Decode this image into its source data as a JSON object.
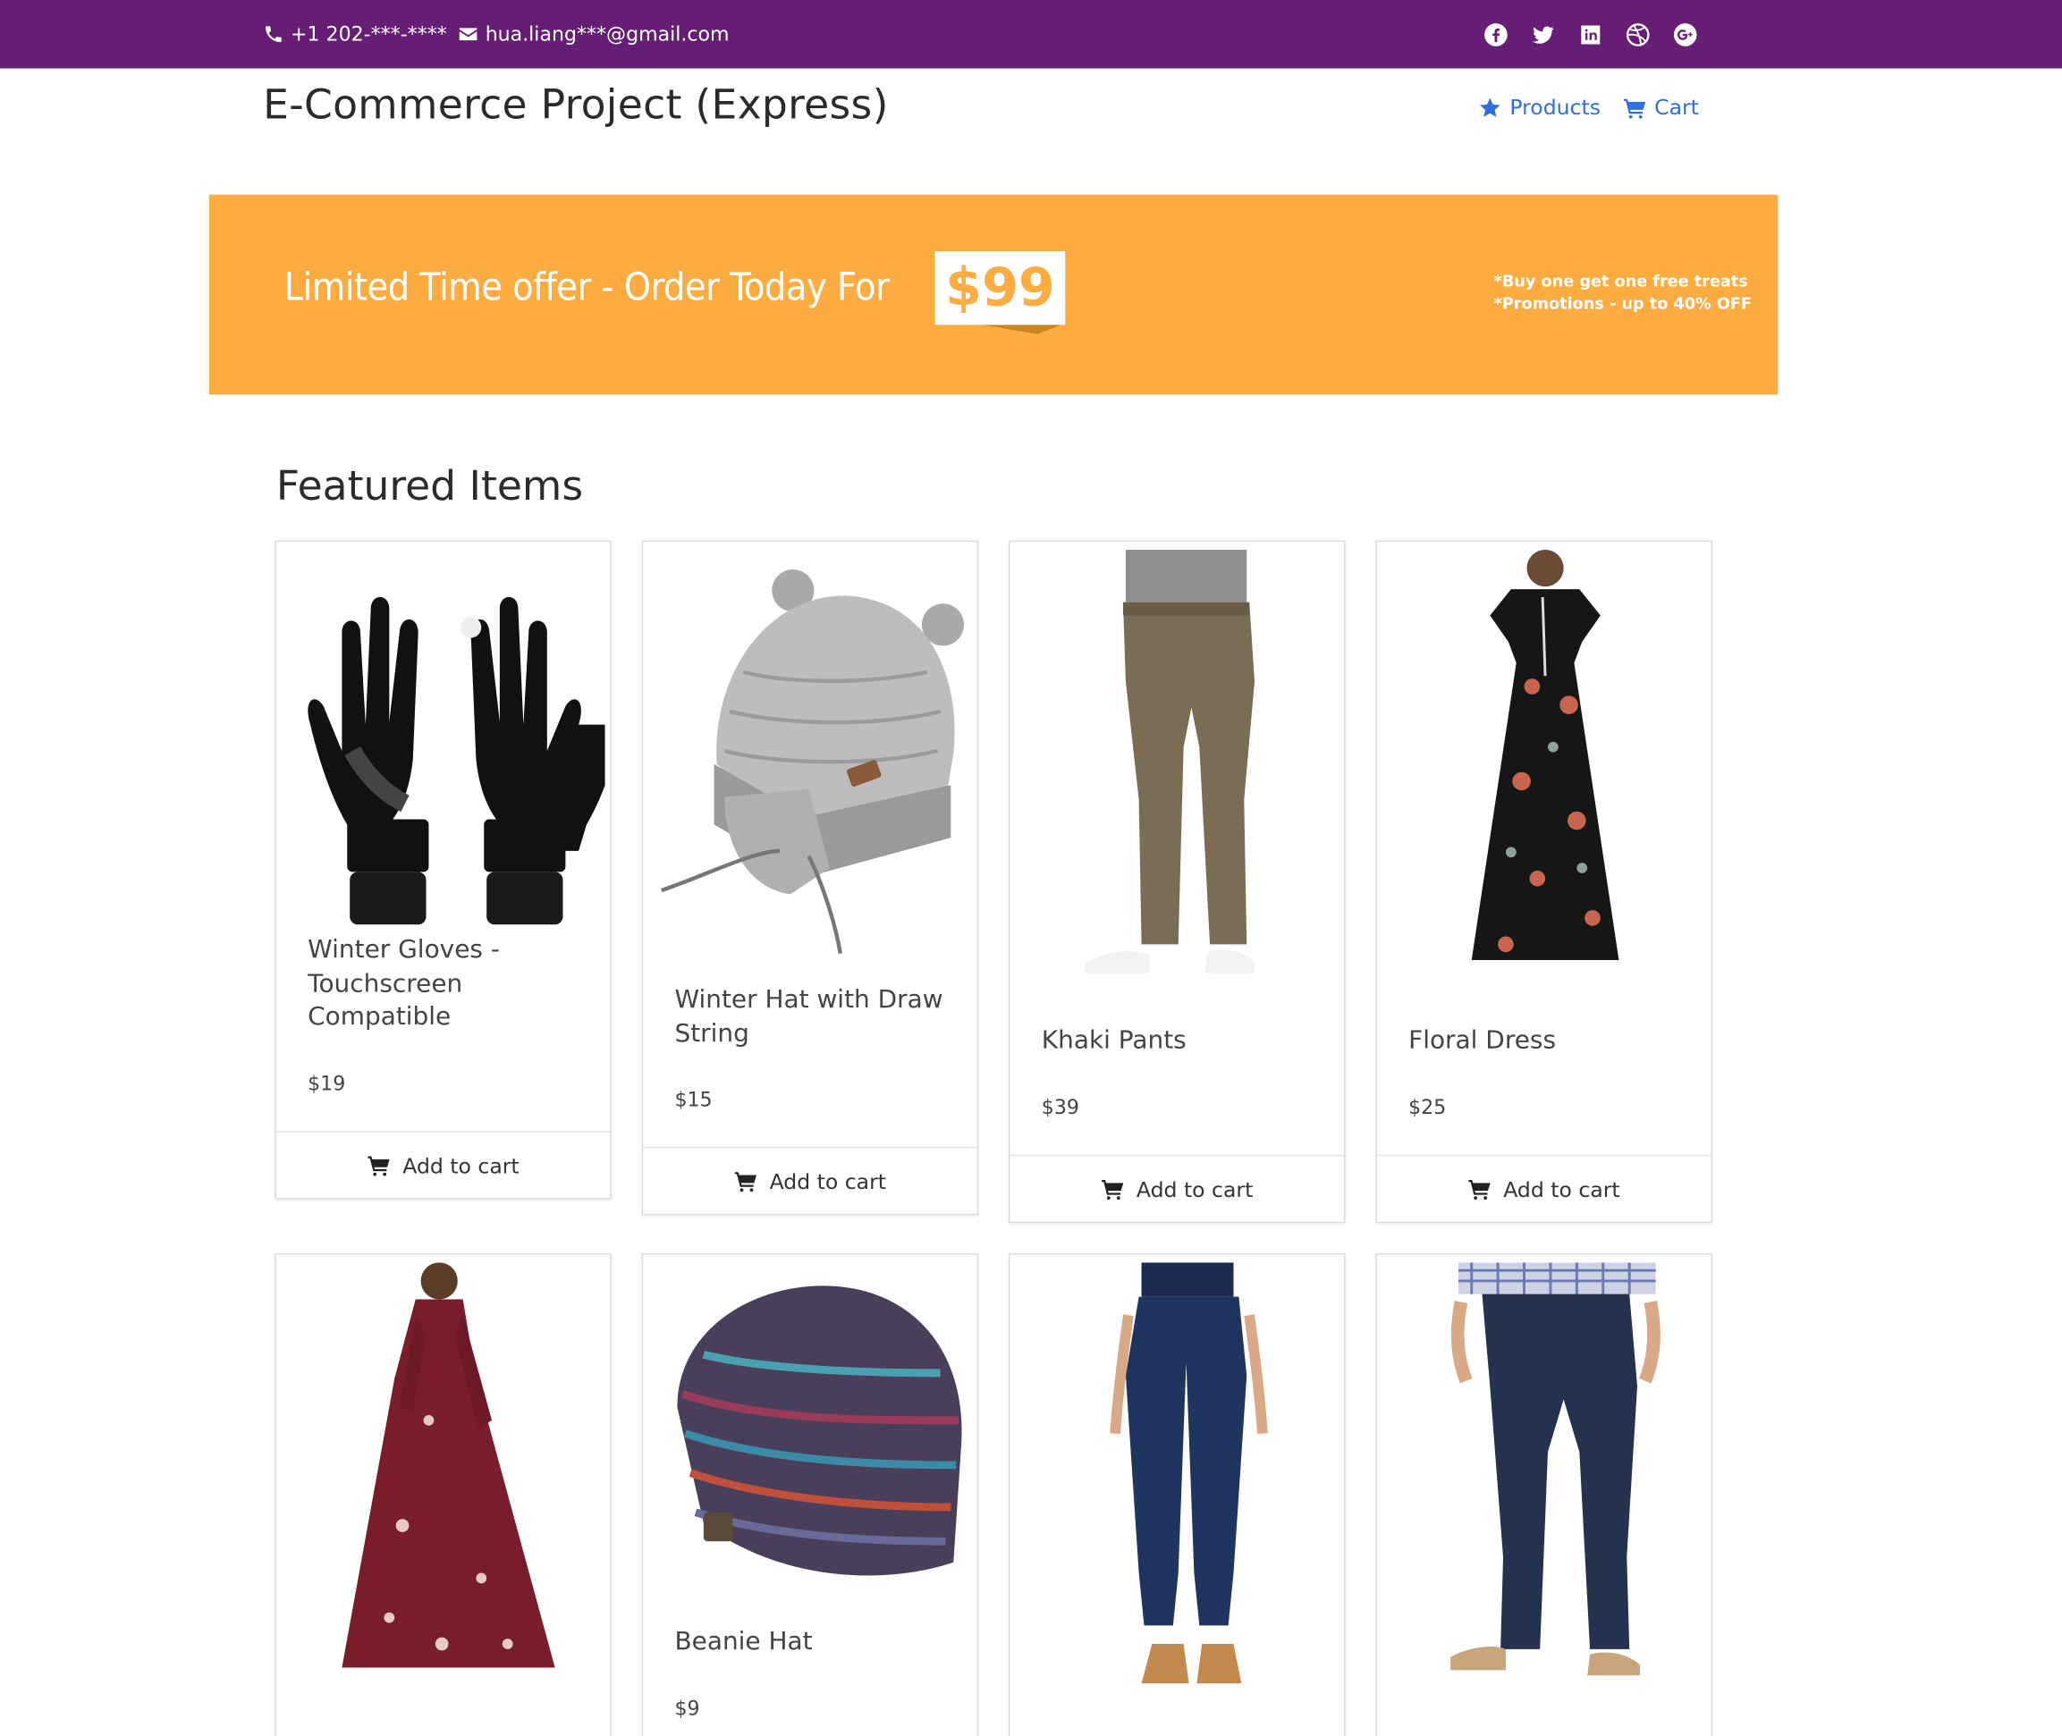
{
  "topbar": {
    "phone": "+1 202-***-****",
    "email": "hua.liang***@gmail.com",
    "social_icons": [
      "facebook-icon",
      "twitter-icon",
      "linkedin-icon",
      "dribbble-icon",
      "google-plus-icon"
    ]
  },
  "header": {
    "brand": "E-Commerce Project (Express)",
    "nav": [
      {
        "label": "Products",
        "icon": "star-icon"
      },
      {
        "label": "Cart",
        "icon": "cart-icon"
      }
    ]
  },
  "banner": {
    "headline": "Limited Time offer - Order Today For",
    "price": "$99",
    "promo_line1": "*Buy one get one free treats",
    "promo_line2": "*Promotions - up to 40% OFF"
  },
  "section": {
    "title": "Featured Items"
  },
  "products": [
    {
      "title": "Winter Gloves - Touchscreen Compatible",
      "price": "$19",
      "action": "Add to cart"
    },
    {
      "title": "Winter Hat with Draw String",
      "price": "$15",
      "action": "Add to cart"
    },
    {
      "title": "Khaki Pants",
      "price": "$39",
      "action": "Add to cart"
    },
    {
      "title": "Floral Dress",
      "price": "$25",
      "action": "Add to cart"
    },
    {
      "title": "",
      "price": "",
      "action": ""
    },
    {
      "title": "Beanie Hat",
      "price": "$9",
      "action": ""
    },
    {
      "title": "",
      "price": "",
      "action": ""
    },
    {
      "title": "",
      "price": "",
      "action": ""
    }
  ],
  "colors": {
    "topbar": "#661e74",
    "banner": "#fdac42",
    "link": "#2f6fdc"
  }
}
